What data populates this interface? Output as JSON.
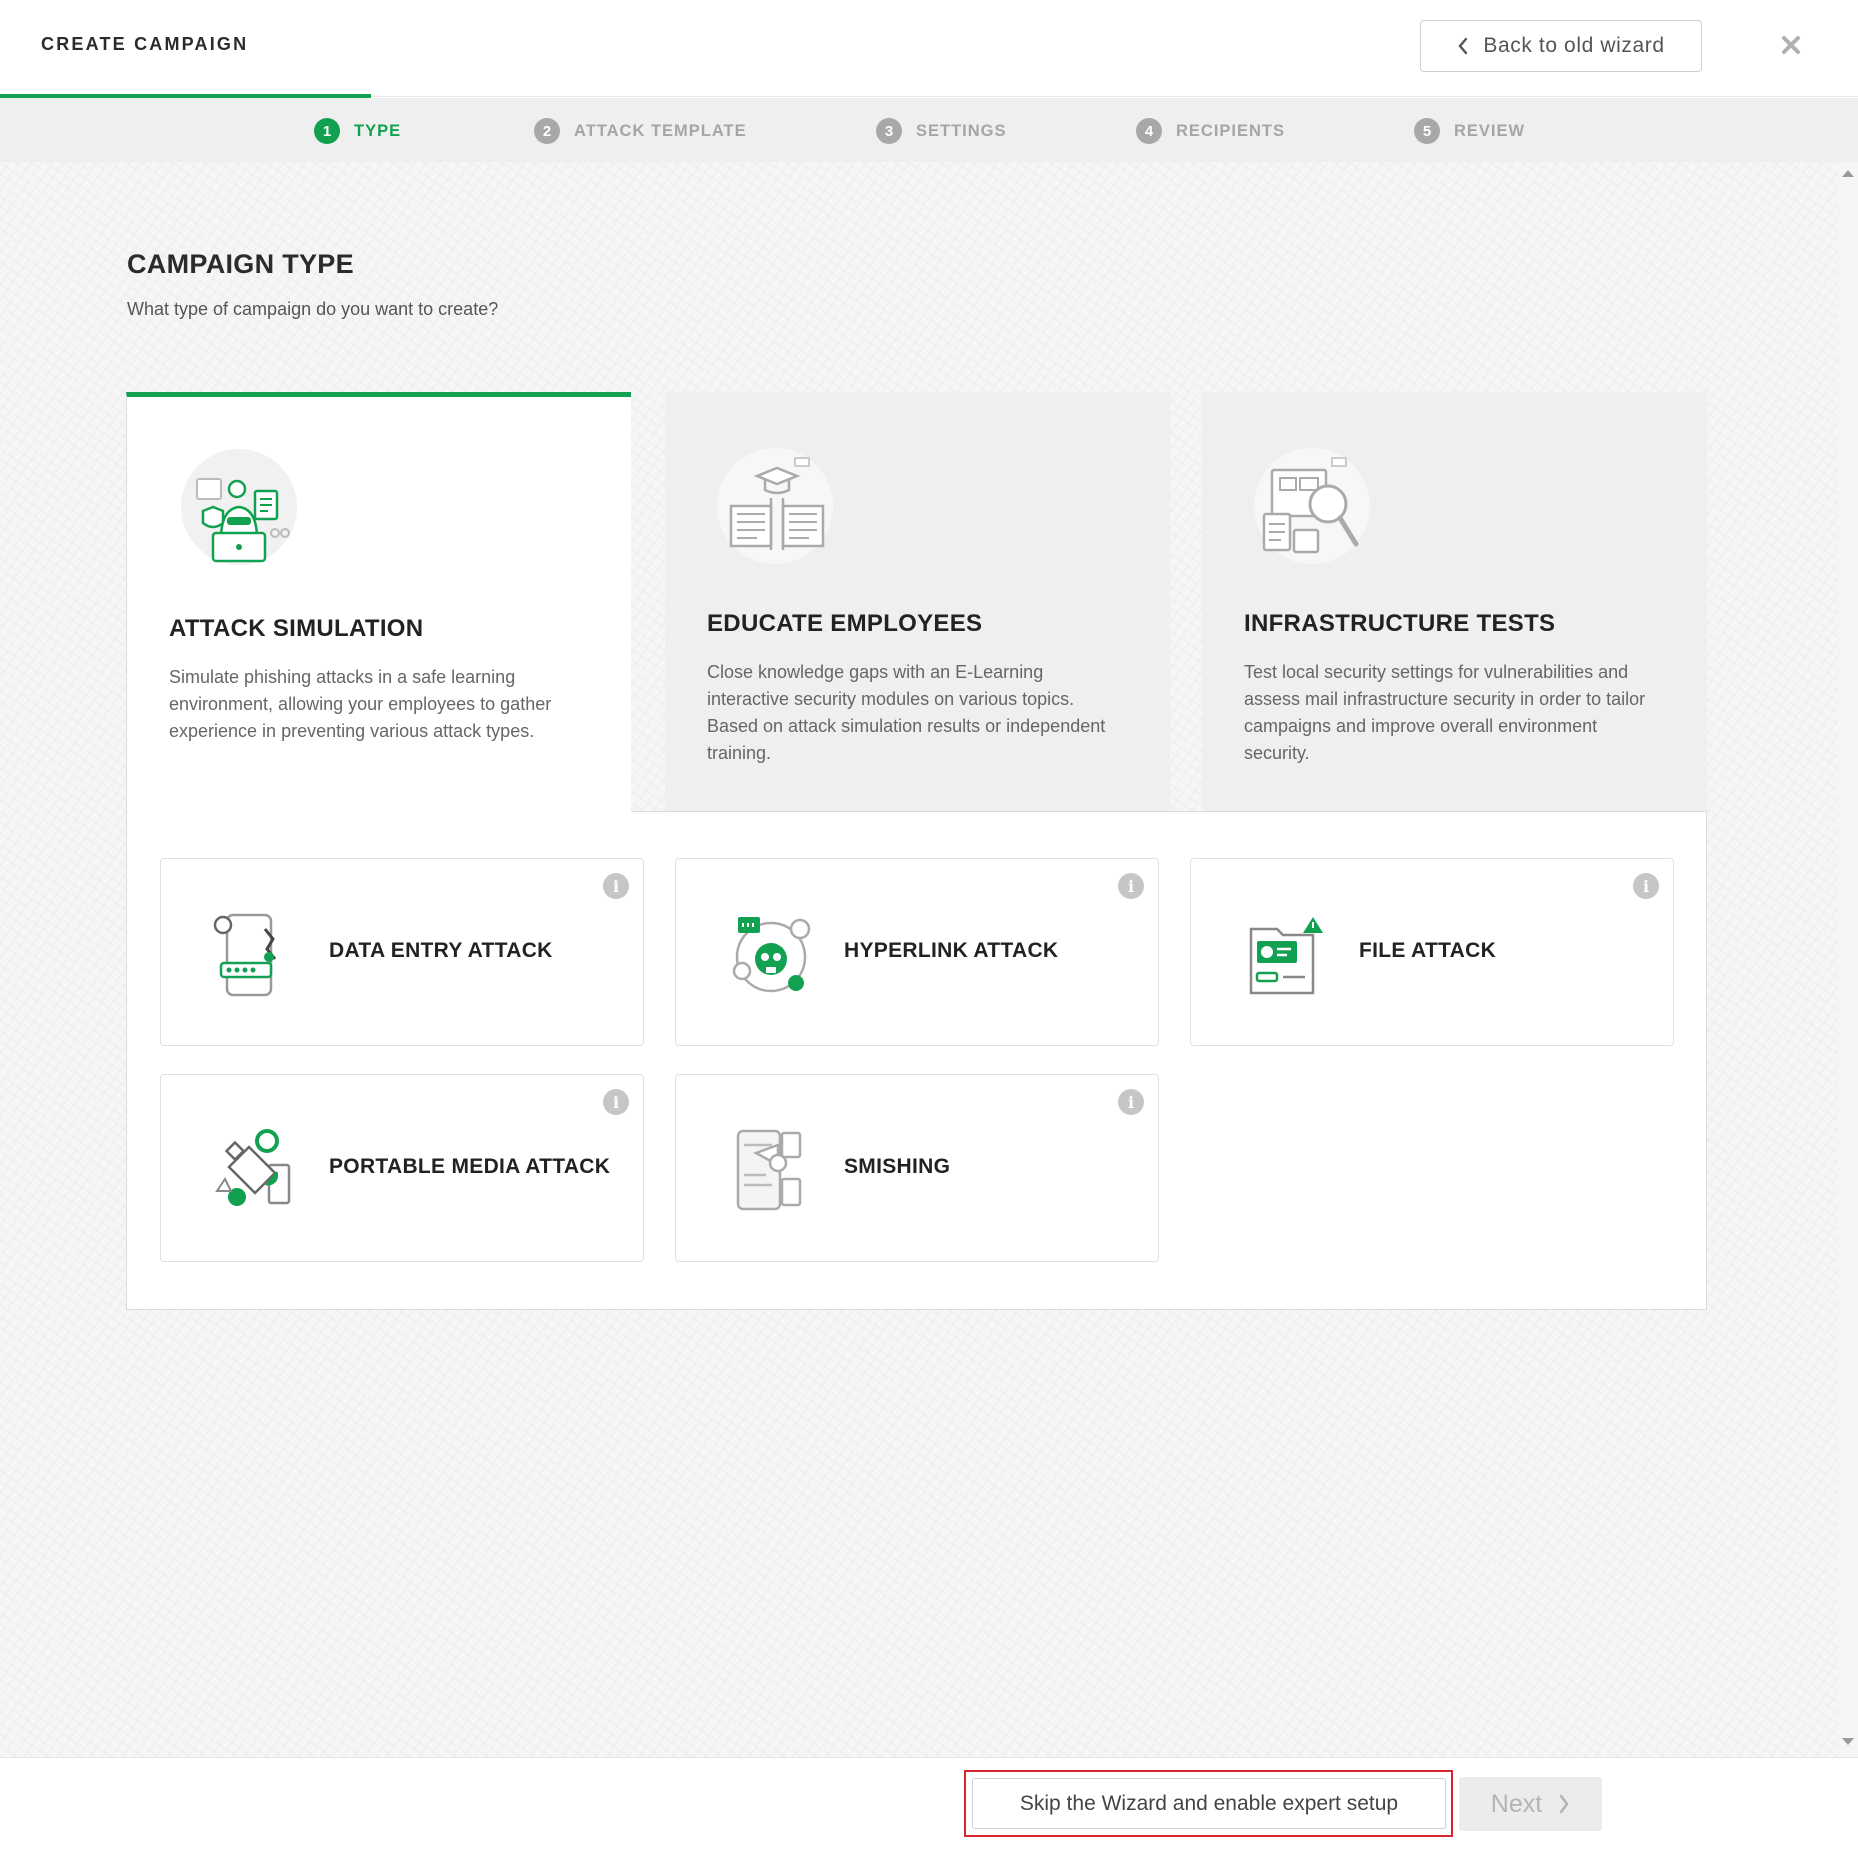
{
  "header": {
    "title": "CREATE CAMPAIGN",
    "back_label": "Back to old wizard",
    "back_icon": "chevron-left-icon",
    "close_icon": "close-icon"
  },
  "steps": [
    {
      "num": "1",
      "label": "TYPE",
      "active": true
    },
    {
      "num": "2",
      "label": "ATTACK TEMPLATE",
      "active": false
    },
    {
      "num": "3",
      "label": "SETTINGS",
      "active": false
    },
    {
      "num": "4",
      "label": "RECIPIENTS",
      "active": false
    },
    {
      "num": "5",
      "label": "REVIEW",
      "active": false
    }
  ],
  "main": {
    "title": "CAMPAIGN TYPE",
    "subtitle": "What type of campaign do you want to create?"
  },
  "campaign_types": [
    {
      "title": "ATTACK SIMULATION",
      "description": "Simulate phishing attacks in a safe learning environment, allowing your employees to gather experience in preventing various attack types.",
      "selected": true,
      "icon": "hacker-laptop-icon"
    },
    {
      "title": "EDUCATE EMPLOYEES",
      "description": "Close knowledge gaps with an E-Learning interactive security modules on various topics. Based on attack simulation results or independent training.",
      "selected": false,
      "icon": "open-book-graduation-icon"
    },
    {
      "title": "INFRASTRUCTURE TESTS",
      "description": "Test local security settings for vulnerabilities and assess mail infrastructure security in order to tailor campaigns and improve overall environment security.",
      "selected": false,
      "icon": "magnifier-documents-icon"
    }
  ],
  "attacks": [
    {
      "title": "DATA ENTRY ATTACK",
      "icon": "phone-password-icon"
    },
    {
      "title": "HYPERLINK ATTACK",
      "icon": "skull-link-icon"
    },
    {
      "title": "FILE ATTACK",
      "icon": "folder-warning-icon"
    },
    {
      "title": "PORTABLE MEDIA ATTACK",
      "icon": "usb-drive-icon"
    },
    {
      "title": "SMISHING",
      "icon": "phone-sms-icon"
    }
  ],
  "info_icon": "i",
  "footer": {
    "skip_label": "Skip the Wizard and enable expert setup",
    "next_label": "Next",
    "next_enabled": false
  },
  "colors": {
    "accent": "#12a150",
    "highlight": "#d9252f",
    "muted": "#a8a8a8"
  }
}
